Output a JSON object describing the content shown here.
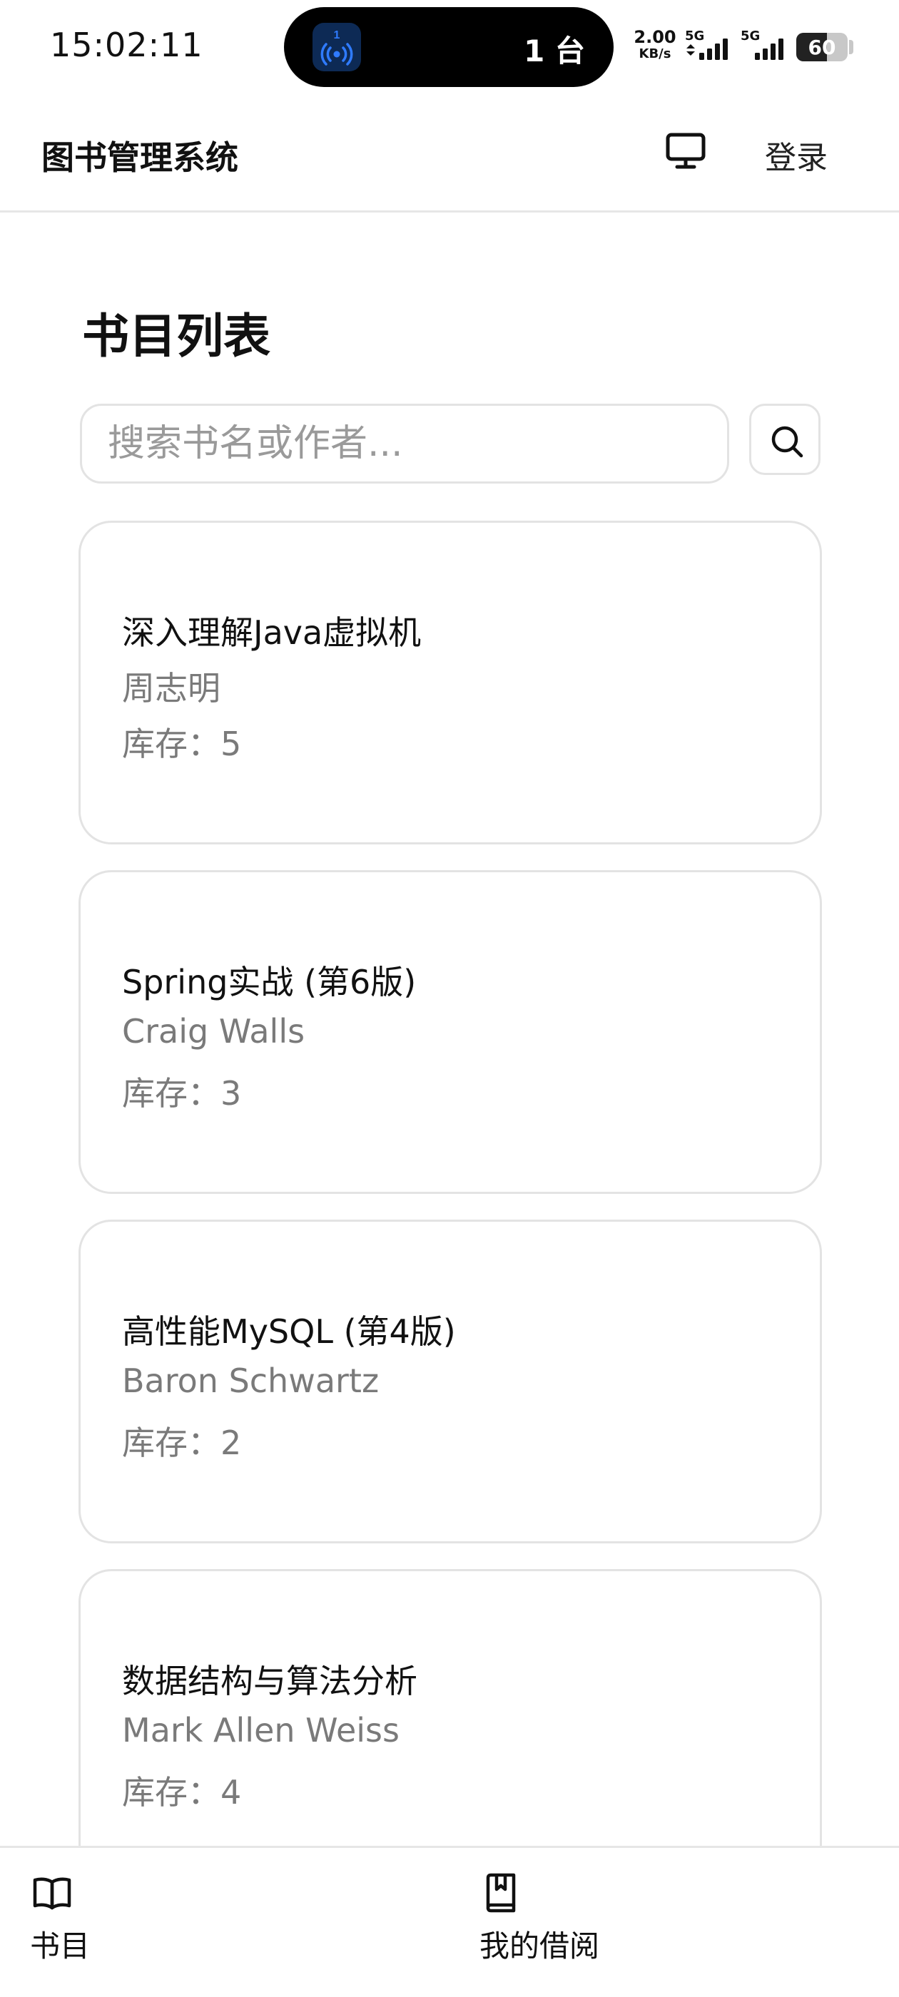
{
  "status_bar": {
    "time": "15:02:11",
    "island_count": "1 台",
    "island_app_badge": "1",
    "net_speed_value": "2.00",
    "net_speed_unit": "KB/s",
    "signal_1_label": "5G",
    "signal_2_label": "5G",
    "battery_level": "60",
    "battery_fraction": 0.6
  },
  "header": {
    "title": "图书管理系统",
    "login_label": "登录",
    "monitor_icon": "monitor-icon"
  },
  "main": {
    "page_title": "书目列表",
    "search": {
      "placeholder": "搜索书名或作者...",
      "value": "",
      "button_icon": "search-icon"
    },
    "books": [
      {
        "title": "深入理解Java虚拟机",
        "author": "周志明",
        "stock": "库存：5"
      },
      {
        "title": "Spring实战 (第6版)",
        "author": "Craig Walls",
        "stock": "库存：3"
      },
      {
        "title": "高性能MySQL (第4版)",
        "author": "Baron Schwartz",
        "stock": "库存：2"
      },
      {
        "title": "数据结构与算法分析",
        "author": "Mark Allen Weiss",
        "stock": "库存：4"
      }
    ]
  },
  "bottom_nav": {
    "items": [
      {
        "label": "书目",
        "icon": "book-open-icon"
      },
      {
        "label": "我的借阅",
        "icon": "bookmark-book-icon"
      }
    ]
  },
  "colors": {
    "text": "#111111",
    "muted_text": "#7a7a7a",
    "border": "#e3e3e3",
    "island_accent": "#2f7bff"
  }
}
